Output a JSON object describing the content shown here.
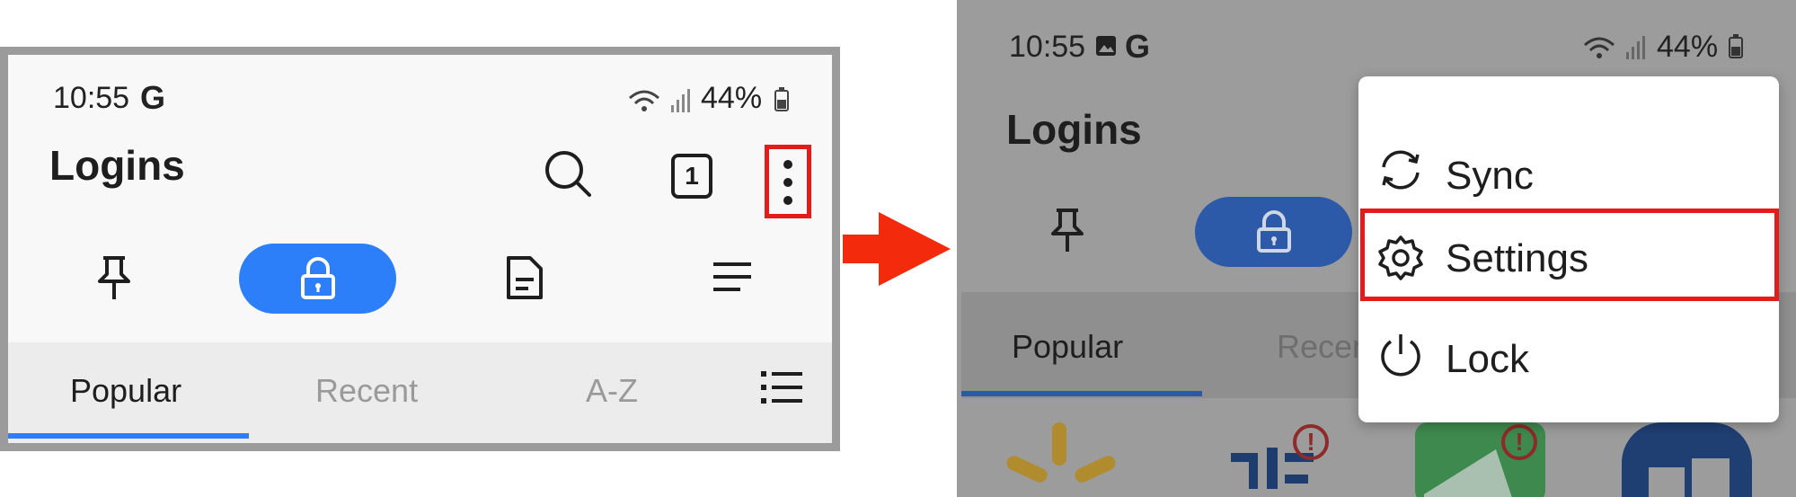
{
  "left": {
    "status": {
      "time": "10:55",
      "g_badge": "G",
      "battery": "44%"
    },
    "header": {
      "title": "Logins",
      "tab_count": "1"
    },
    "sub_tabs": [
      "Popular",
      "Recent",
      "A-Z"
    ],
    "icons": [
      "pin-icon",
      "lock-icon",
      "document-icon",
      "menu-icon",
      "search-icon",
      "more-vert-icon",
      "list-icon"
    ]
  },
  "right": {
    "status": {
      "time": "10:55",
      "g_badge": "G",
      "battery": "44%"
    },
    "header": {
      "title": "Logins"
    },
    "sub_tabs": [
      "Popular",
      "Recen"
    ],
    "menu": {
      "items": [
        {
          "label": "Sync",
          "icon": "sync-icon"
        },
        {
          "label": "Settings",
          "icon": "gear-icon"
        },
        {
          "label": "Lock",
          "icon": "power-icon"
        }
      ]
    },
    "tiles": {
      "alert_mark": "!"
    }
  },
  "colors": {
    "accent": "#2d7ff9",
    "highlight": "#e41b1b",
    "arrow": "#f32a0c"
  }
}
